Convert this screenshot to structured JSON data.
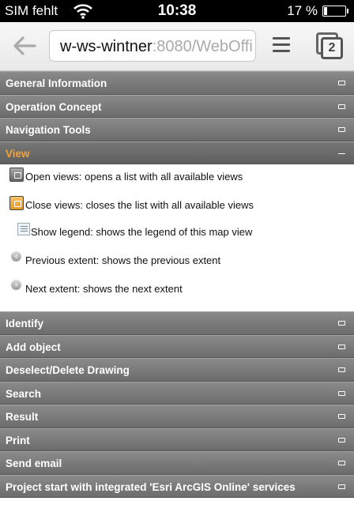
{
  "status_bar": {
    "carrier": "SIM fehlt",
    "time": "10:38",
    "battery_percent": "17 %",
    "battery_level": 0.17
  },
  "toolbar": {
    "url_host": "w-ws-wintner",
    "url_rest": ":8080/WebOffi",
    "tab_count": "2"
  },
  "accordion": {
    "sections_before": [
      {
        "title": "General Information"
      },
      {
        "title": "Operation Concept"
      },
      {
        "title": "Navigation Tools"
      }
    ],
    "open_section": {
      "title": "View",
      "items": [
        {
          "icon": "open-views-icon",
          "text": "Open views: opens a list with all available views"
        },
        {
          "icon": "close-views-icon",
          "text": "Close views: closes the list with all available views"
        },
        {
          "icon": "legend-icon",
          "text": "Show legend: shows the legend of this map view"
        },
        {
          "icon": "previous-extent-icon",
          "text": "Previous extent: shows the previous extent"
        },
        {
          "icon": "next-extent-icon",
          "text": "Next extent: shows the next extent"
        }
      ]
    },
    "sections_after": [
      {
        "title": "Identify"
      },
      {
        "title": "Add object"
      },
      {
        "title": "Deselect/Delete Drawing"
      },
      {
        "title": "Search"
      },
      {
        "title": "Result"
      },
      {
        "title": "Print"
      },
      {
        "title": "Send email"
      },
      {
        "title": "Project start with integrated 'Esri ArcGIS Online' services"
      }
    ]
  },
  "colors": {
    "header_bg": "#7a7a7a",
    "active_title": "#f0a23c",
    "status_bar_bg": "#000000"
  }
}
